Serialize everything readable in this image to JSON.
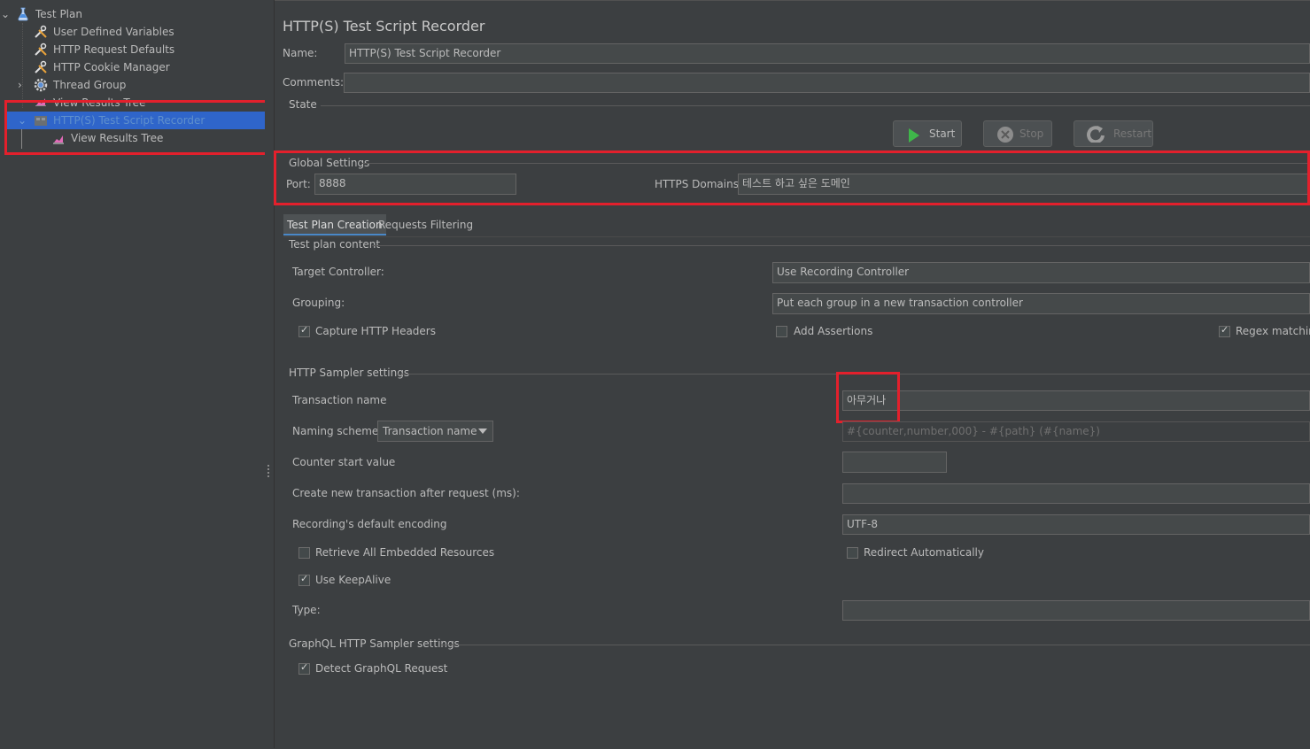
{
  "tree": {
    "items": [
      {
        "label": "Test Plan",
        "icon": "flask-icon"
      },
      {
        "label": "User Defined Variables",
        "icon": "wrench-icon"
      },
      {
        "label": "HTTP Request Defaults",
        "icon": "wrench-icon"
      },
      {
        "label": "HTTP Cookie Manager",
        "icon": "wrench-icon"
      },
      {
        "label": "Thread Group",
        "icon": "gear-icon"
      },
      {
        "label": "View Results Tree",
        "icon": "chart-icon"
      },
      {
        "label": "HTTP(S) Test Script Recorder",
        "icon": "recorder-icon"
      },
      {
        "label": "View Results Tree",
        "icon": "chart-icon"
      }
    ]
  },
  "recorder": {
    "title": "HTTP(S) Test Script Recorder",
    "name_label": "Name:",
    "name_value": "HTTP(S) Test Script Recorder",
    "comments_label": "Comments:",
    "comments_value": "",
    "state_label": "State",
    "start_label": "Start",
    "stop_label": "Stop",
    "restart_label": "Restart"
  },
  "global": {
    "title": "Global Settings",
    "port_label": "Port:",
    "port_value": "8888",
    "https_label": "HTTPS Domains:",
    "https_value": "테스트 하고 싶은 도메인"
  },
  "tabs": [
    {
      "label": "Test Plan Creation",
      "active": true
    },
    {
      "label": "Requests Filtering",
      "active": false
    }
  ],
  "test_plan": {
    "title": "Test plan content",
    "target_label": "Target Controller:",
    "target_value": "Use Recording Controller",
    "grouping_label": "Grouping:",
    "grouping_value": "Put each group in a new transaction controller",
    "capture_headers_label": "Capture HTTP Headers",
    "capture_headers_checked": true,
    "add_assertions_label": "Add Assertions",
    "add_assertions_checked": false,
    "regex_label": "Regex matching",
    "regex_checked": true
  },
  "sampler": {
    "title": "HTTP Sampler settings",
    "transaction_label": "Transaction name",
    "transaction_value": "아무거나",
    "naming_label": "Naming scheme",
    "naming_value": "Transaction name",
    "naming_format": "#{counter,number,000} - #{path} (#{name})",
    "counter_label": "Counter start value",
    "counter_value": "",
    "create_new_label": "Create new transaction after request (ms):",
    "create_new_value": "",
    "encoding_label": "Recording's default encoding",
    "encoding_value": "UTF-8",
    "retrieve_label": "Retrieve All Embedded Resources",
    "retrieve_checked": false,
    "redirect_label": "Redirect Automatically",
    "redirect_checked": false,
    "keepalive_label": "Use KeepAlive",
    "keepalive_checked": true,
    "type_label": "Type:",
    "type_value": ""
  },
  "graphql": {
    "title": "GraphQL HTTP Sampler settings",
    "detect_label": "Detect GraphQL Request",
    "detect_checked": true
  },
  "colors": {
    "background": "#3c3f41",
    "selection": "#2f65ca",
    "highlight_box": "#e3202c",
    "start_icon": "#3fb64a"
  }
}
